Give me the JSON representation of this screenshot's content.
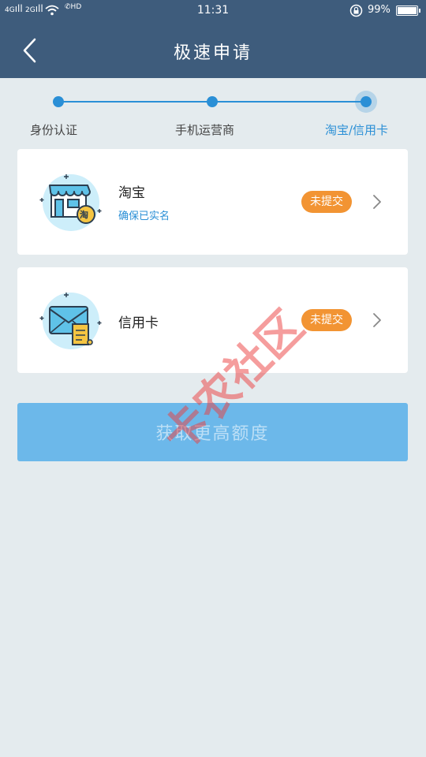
{
  "status_bar": {
    "net1": "4G",
    "net2": "2G",
    "hd": "HD",
    "time": "11:31",
    "battery": "99%"
  },
  "nav": {
    "title": "极速申请"
  },
  "steps": [
    {
      "label": "身份认证",
      "active": false
    },
    {
      "label": "手机运营商",
      "active": false
    },
    {
      "label": "淘宝/信用卡",
      "active": true
    }
  ],
  "cards": [
    {
      "title": "淘宝",
      "subtitle": "确保已实名",
      "status": "未提交",
      "icon": "taobao-shop-icon",
      "icon_badge": "淘"
    },
    {
      "title": "信用卡",
      "subtitle": "",
      "status": "未提交",
      "icon": "credit-card-envelope-icon"
    }
  ],
  "submit_button": {
    "label": "获取更高额度"
  },
  "watermark": "卡农社区",
  "colors": {
    "header": "#3e5c7c",
    "background": "#e4ebee",
    "accent": "#2a8fd6",
    "badge": "#f29433",
    "button": "#6cb8ea"
  }
}
